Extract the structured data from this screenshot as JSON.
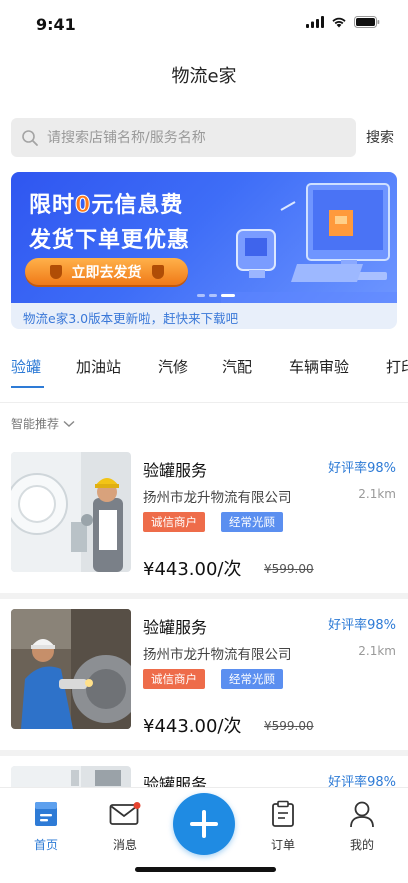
{
  "status_bar": {
    "time": "9:41"
  },
  "app": {
    "title": "物流e家"
  },
  "search": {
    "placeholder": "请搜索店铺名称/服务名称",
    "button_label": "搜索"
  },
  "banner": {
    "line1_prefix": "限时",
    "line1_zero": "0",
    "line1_suffix": "元信息费",
    "line2": "发货下单更优惠",
    "cta_label": "立即去发货",
    "notice": "物流e家3.0版本更新啦，赶快来下载吧"
  },
  "categories": [
    {
      "label": "验罐",
      "active": true
    },
    {
      "label": "加油站",
      "active": false
    },
    {
      "label": "汽修",
      "active": false
    },
    {
      "label": "汽配",
      "active": false
    },
    {
      "label": "车辆审验",
      "active": false
    },
    {
      "label": "打印",
      "active": false
    }
  ],
  "sort": {
    "label": "智能推荐"
  },
  "services": [
    {
      "title": "验罐服务",
      "rating": "好评率98%",
      "company": "扬州市龙升物流有限公司",
      "distance": "2.1km",
      "tags": [
        "诚信商户",
        "经常光顾"
      ],
      "price": "¥443.00/次",
      "original_price": "¥599.00",
      "image": "technician-at-tank"
    },
    {
      "title": "验罐服务",
      "rating": "好评率98%",
      "company": "扬州市龙升物流有限公司",
      "distance": "2.1km",
      "tags": [
        "诚信商户",
        "经常光顾"
      ],
      "price": "¥443.00/次",
      "original_price": "¥599.00",
      "image": "worker-grinding"
    },
    {
      "title": "验罐服务",
      "rating": "好评率98%",
      "image": "technician-at-tank"
    }
  ],
  "tabbar": {
    "items": [
      {
        "label": "首页",
        "icon": "home-icon",
        "active": true
      },
      {
        "label": "消息",
        "icon": "message-icon",
        "active": false,
        "badge": true
      },
      {
        "label": "订单",
        "icon": "order-icon",
        "active": false
      },
      {
        "label": "我的",
        "icon": "profile-icon",
        "active": false
      }
    ],
    "center_icon": "plus-icon"
  },
  "colors": {
    "accent": "#2e7bd6",
    "fab": "#1f8be3",
    "tag_credit": "#ee6c4a",
    "tag_frequent": "#5b8ff0",
    "banner_blue": "#2f56f0",
    "cta_orange": "#f07a18"
  }
}
